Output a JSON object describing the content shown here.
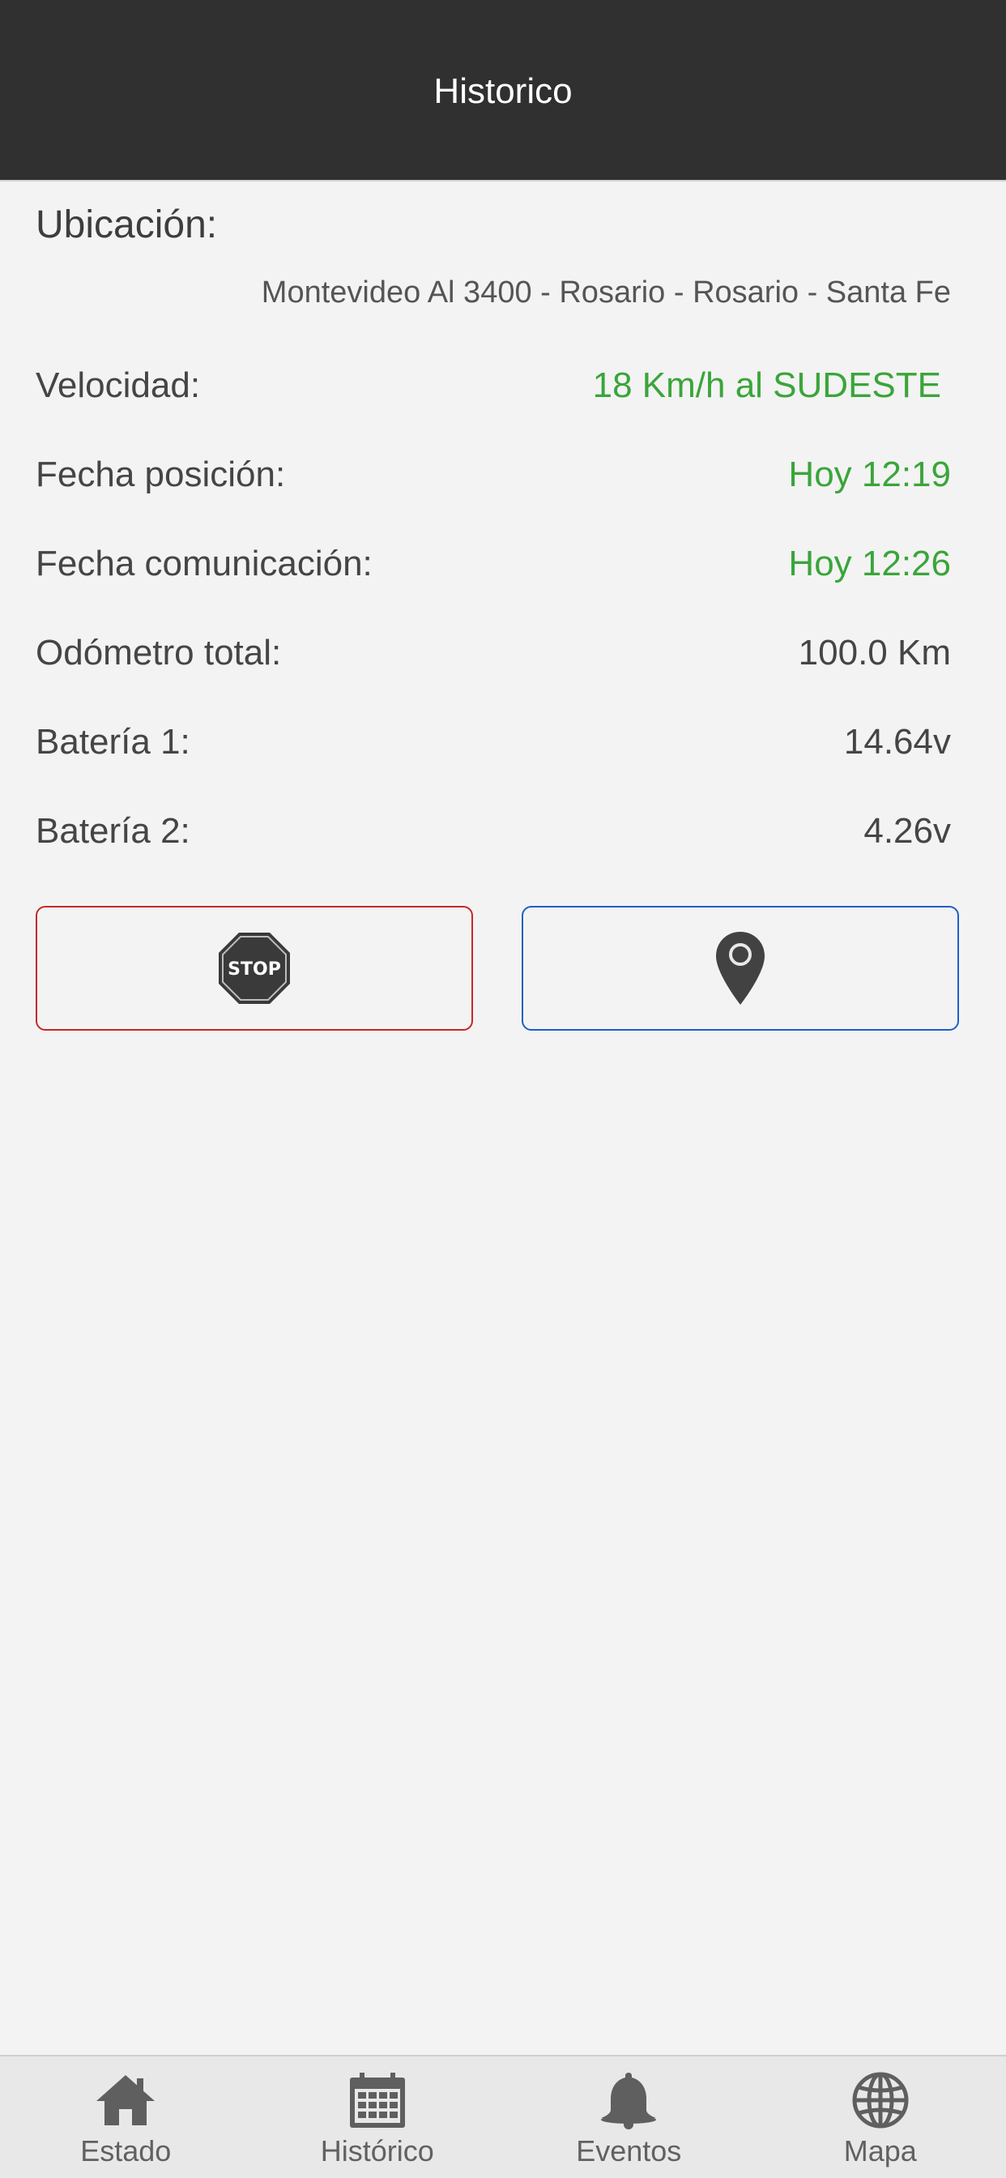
{
  "header": {
    "title": "Historico"
  },
  "location": {
    "label": "Ubicación:",
    "value": "Montevideo Al 3400 - Rosario - Rosario - Santa Fe"
  },
  "rows": [
    {
      "label": "Velocidad:",
      "value": "18 Km/h al SUDESTE",
      "color": "#3aa53a"
    },
    {
      "label": "Fecha posición:",
      "value": "Hoy 12:19",
      "color": "#3aa53a"
    },
    {
      "label": "Fecha comunicación:",
      "value": "Hoy 12:26",
      "color": "#3aa53a"
    },
    {
      "label": "Odómetro total:",
      "value": "100.0 Km",
      "color": "#454545"
    },
    {
      "label": "Batería 1:",
      "value": "14.64v",
      "color": "#454545"
    },
    {
      "label": "Batería 2:",
      "value": "4.26v",
      "color": "#454545"
    }
  ],
  "actions": {
    "stop": {
      "icon": "stop-sign-icon",
      "text": "STOP",
      "border_color": "#c62828"
    },
    "locate": {
      "icon": "map-pin-icon",
      "border_color": "#1e5fc9"
    }
  },
  "nav": [
    {
      "label": "Estado",
      "icon": "home-icon"
    },
    {
      "label": "Histórico",
      "icon": "calendar-icon"
    },
    {
      "label": "Eventos",
      "icon": "bell-icon"
    },
    {
      "label": "Mapa",
      "icon": "globe-icon"
    }
  ]
}
